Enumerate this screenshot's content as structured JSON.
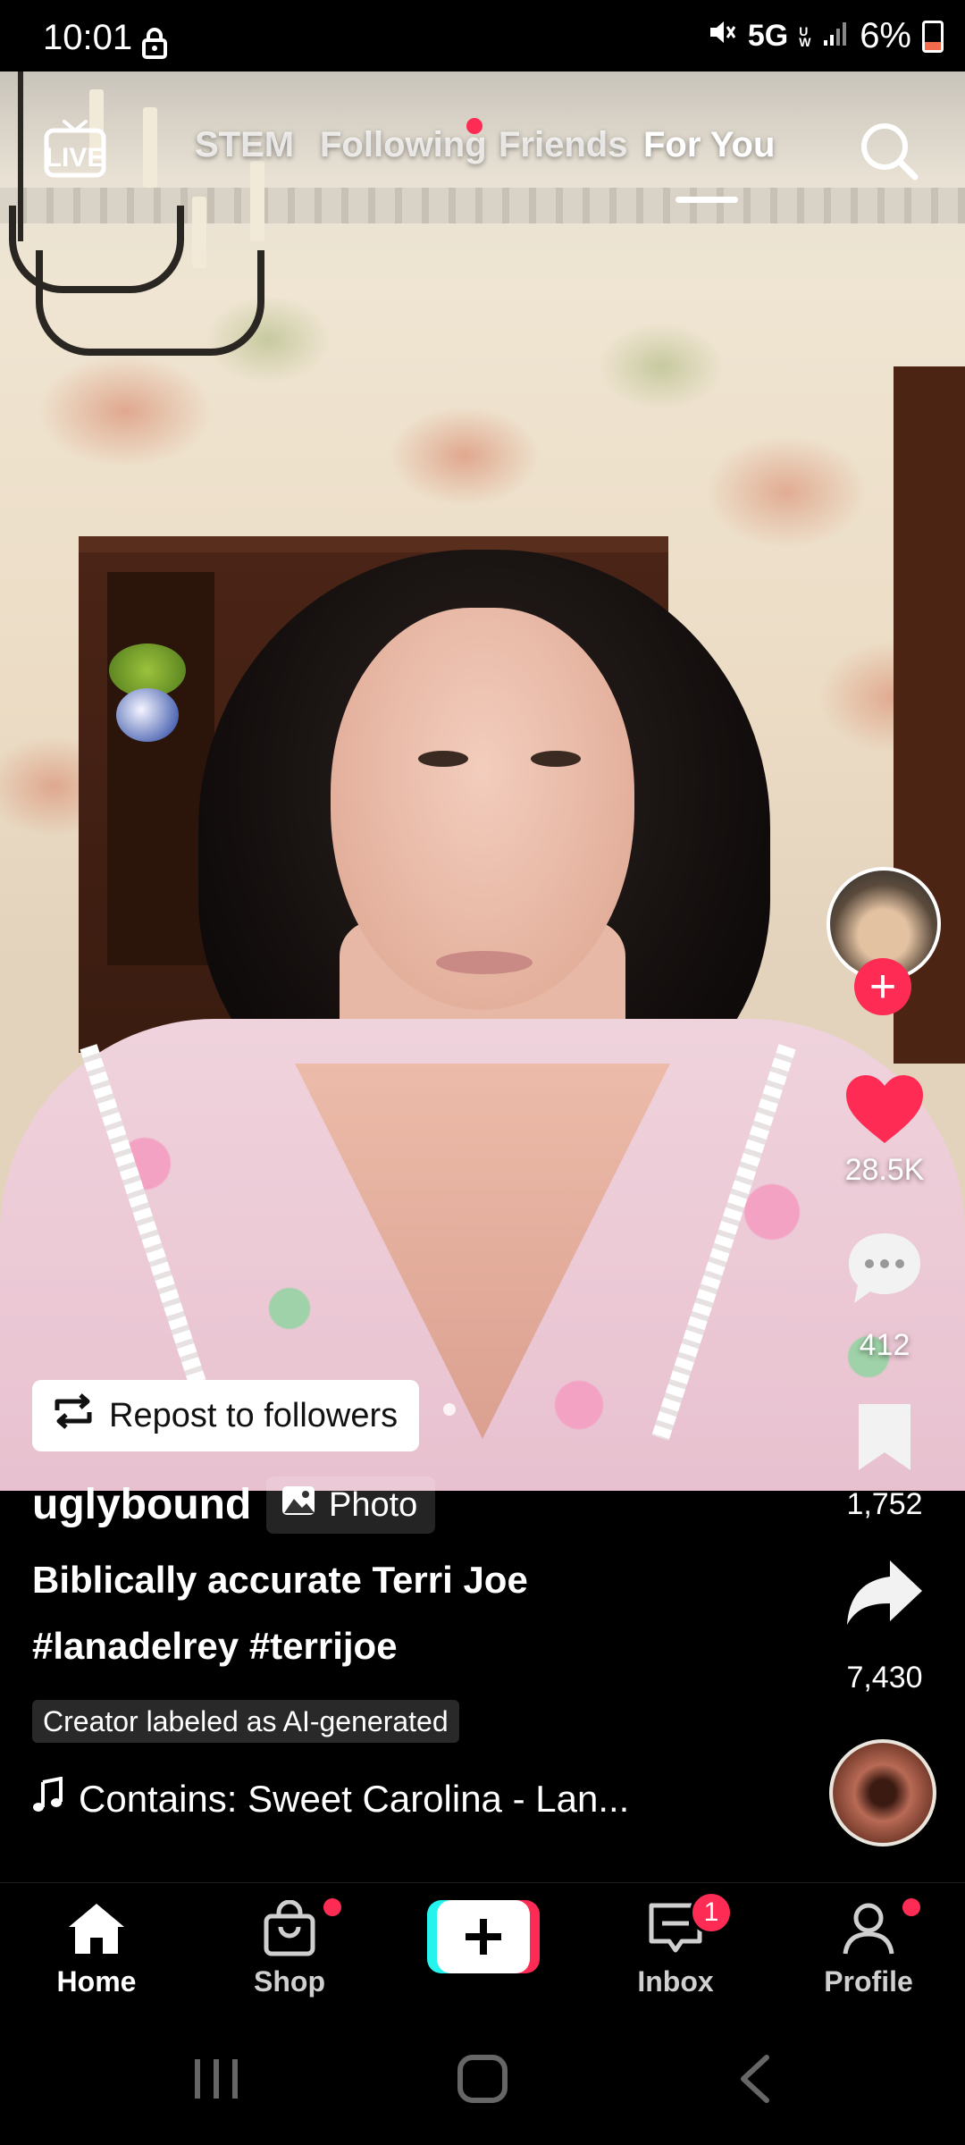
{
  "status_bar": {
    "time": "10:01",
    "network": "5G",
    "network_sub": "UW",
    "battery": "6%"
  },
  "top_tabs": {
    "live_label": "LIVE",
    "tabs": [
      {
        "label": "STEM",
        "active": false
      },
      {
        "label": "Following",
        "active": false,
        "has_dot": true
      },
      {
        "label": "Friends",
        "active": false
      },
      {
        "label": "For You",
        "active": true
      }
    ]
  },
  "actions": {
    "likes": "28.5K",
    "comments": "412",
    "saves": "1,752",
    "shares": "7,430"
  },
  "repost": {
    "label": "Repost to followers"
  },
  "post": {
    "username": "uglybound",
    "type_label": "Photo",
    "caption": "Biblically accurate Terri Joe",
    "hashtags": "#lanadelrey #terrijoe",
    "ai_label": "Creator labeled as AI-generated",
    "music": "Contains: Sweet Carolina - Lan..."
  },
  "bottom_nav": {
    "items": [
      {
        "label": "Home",
        "icon": "home-icon",
        "active": true
      },
      {
        "label": "Shop",
        "icon": "shopping-bag-icon",
        "dot": true
      },
      {
        "label": "",
        "icon": "create-plus-icon"
      },
      {
        "label": "Inbox",
        "icon": "inbox-icon",
        "badge": "1"
      },
      {
        "label": "Profile",
        "icon": "profile-icon",
        "dot": true
      }
    ]
  },
  "colors": {
    "accent": "#fe2c55",
    "create_cyan": "#25f4ee",
    "create_red": "#fe2c55"
  }
}
